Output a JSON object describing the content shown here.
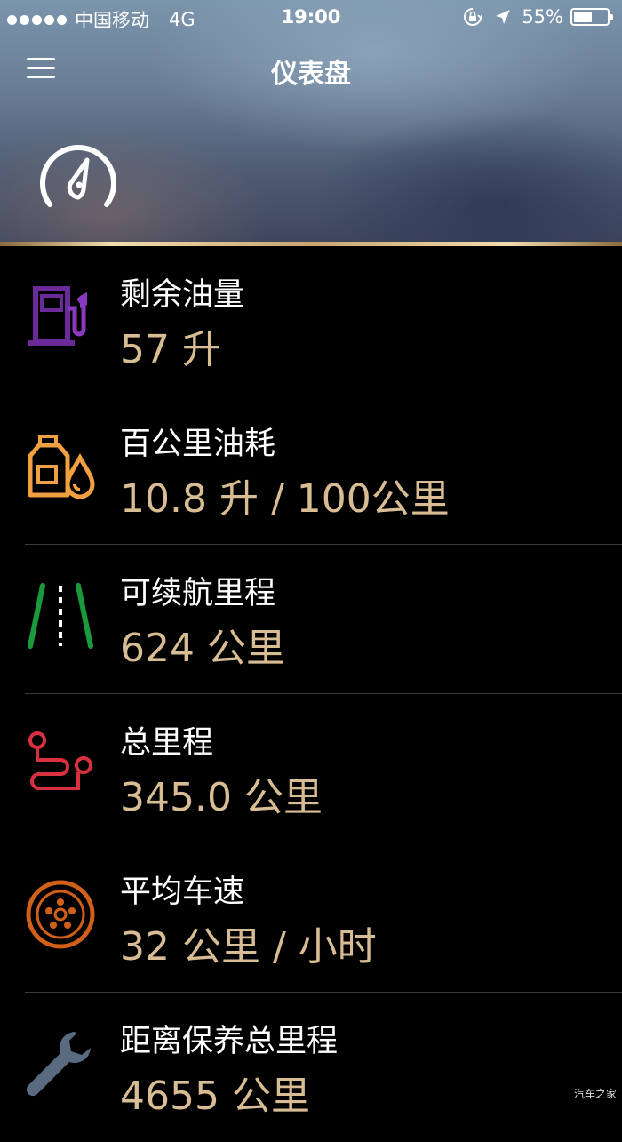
{
  "status_bar": {
    "carrier": "中国移动",
    "network": "4G",
    "time": "19:00",
    "battery_percent": "55%",
    "battery_level": 0.55
  },
  "nav": {
    "title": "仪表盘"
  },
  "items": [
    {
      "label": "剩余油量",
      "value": "57 升",
      "icon": "fuel-pump-icon",
      "color": "#6a2a9a"
    },
    {
      "label": "百公里油耗",
      "value": "10.8 升 / 100公里",
      "icon": "oil-can-icon",
      "color": "#f0a040"
    },
    {
      "label": "可续航里程",
      "value": "624 公里",
      "icon": "road-icon",
      "color": "#1a9a3a"
    },
    {
      "label": "总里程",
      "value": "345.0 公里",
      "icon": "route-icon",
      "color": "#d83040"
    },
    {
      "label": "平均车速",
      "value": "32 公里 / 小时",
      "icon": "tire-icon",
      "color": "#d06018"
    },
    {
      "label": "距离保养总里程",
      "value": "4655 公里",
      "icon": "wrench-icon",
      "color": "#5a6a80"
    }
  ],
  "watermark": "汽车之家"
}
